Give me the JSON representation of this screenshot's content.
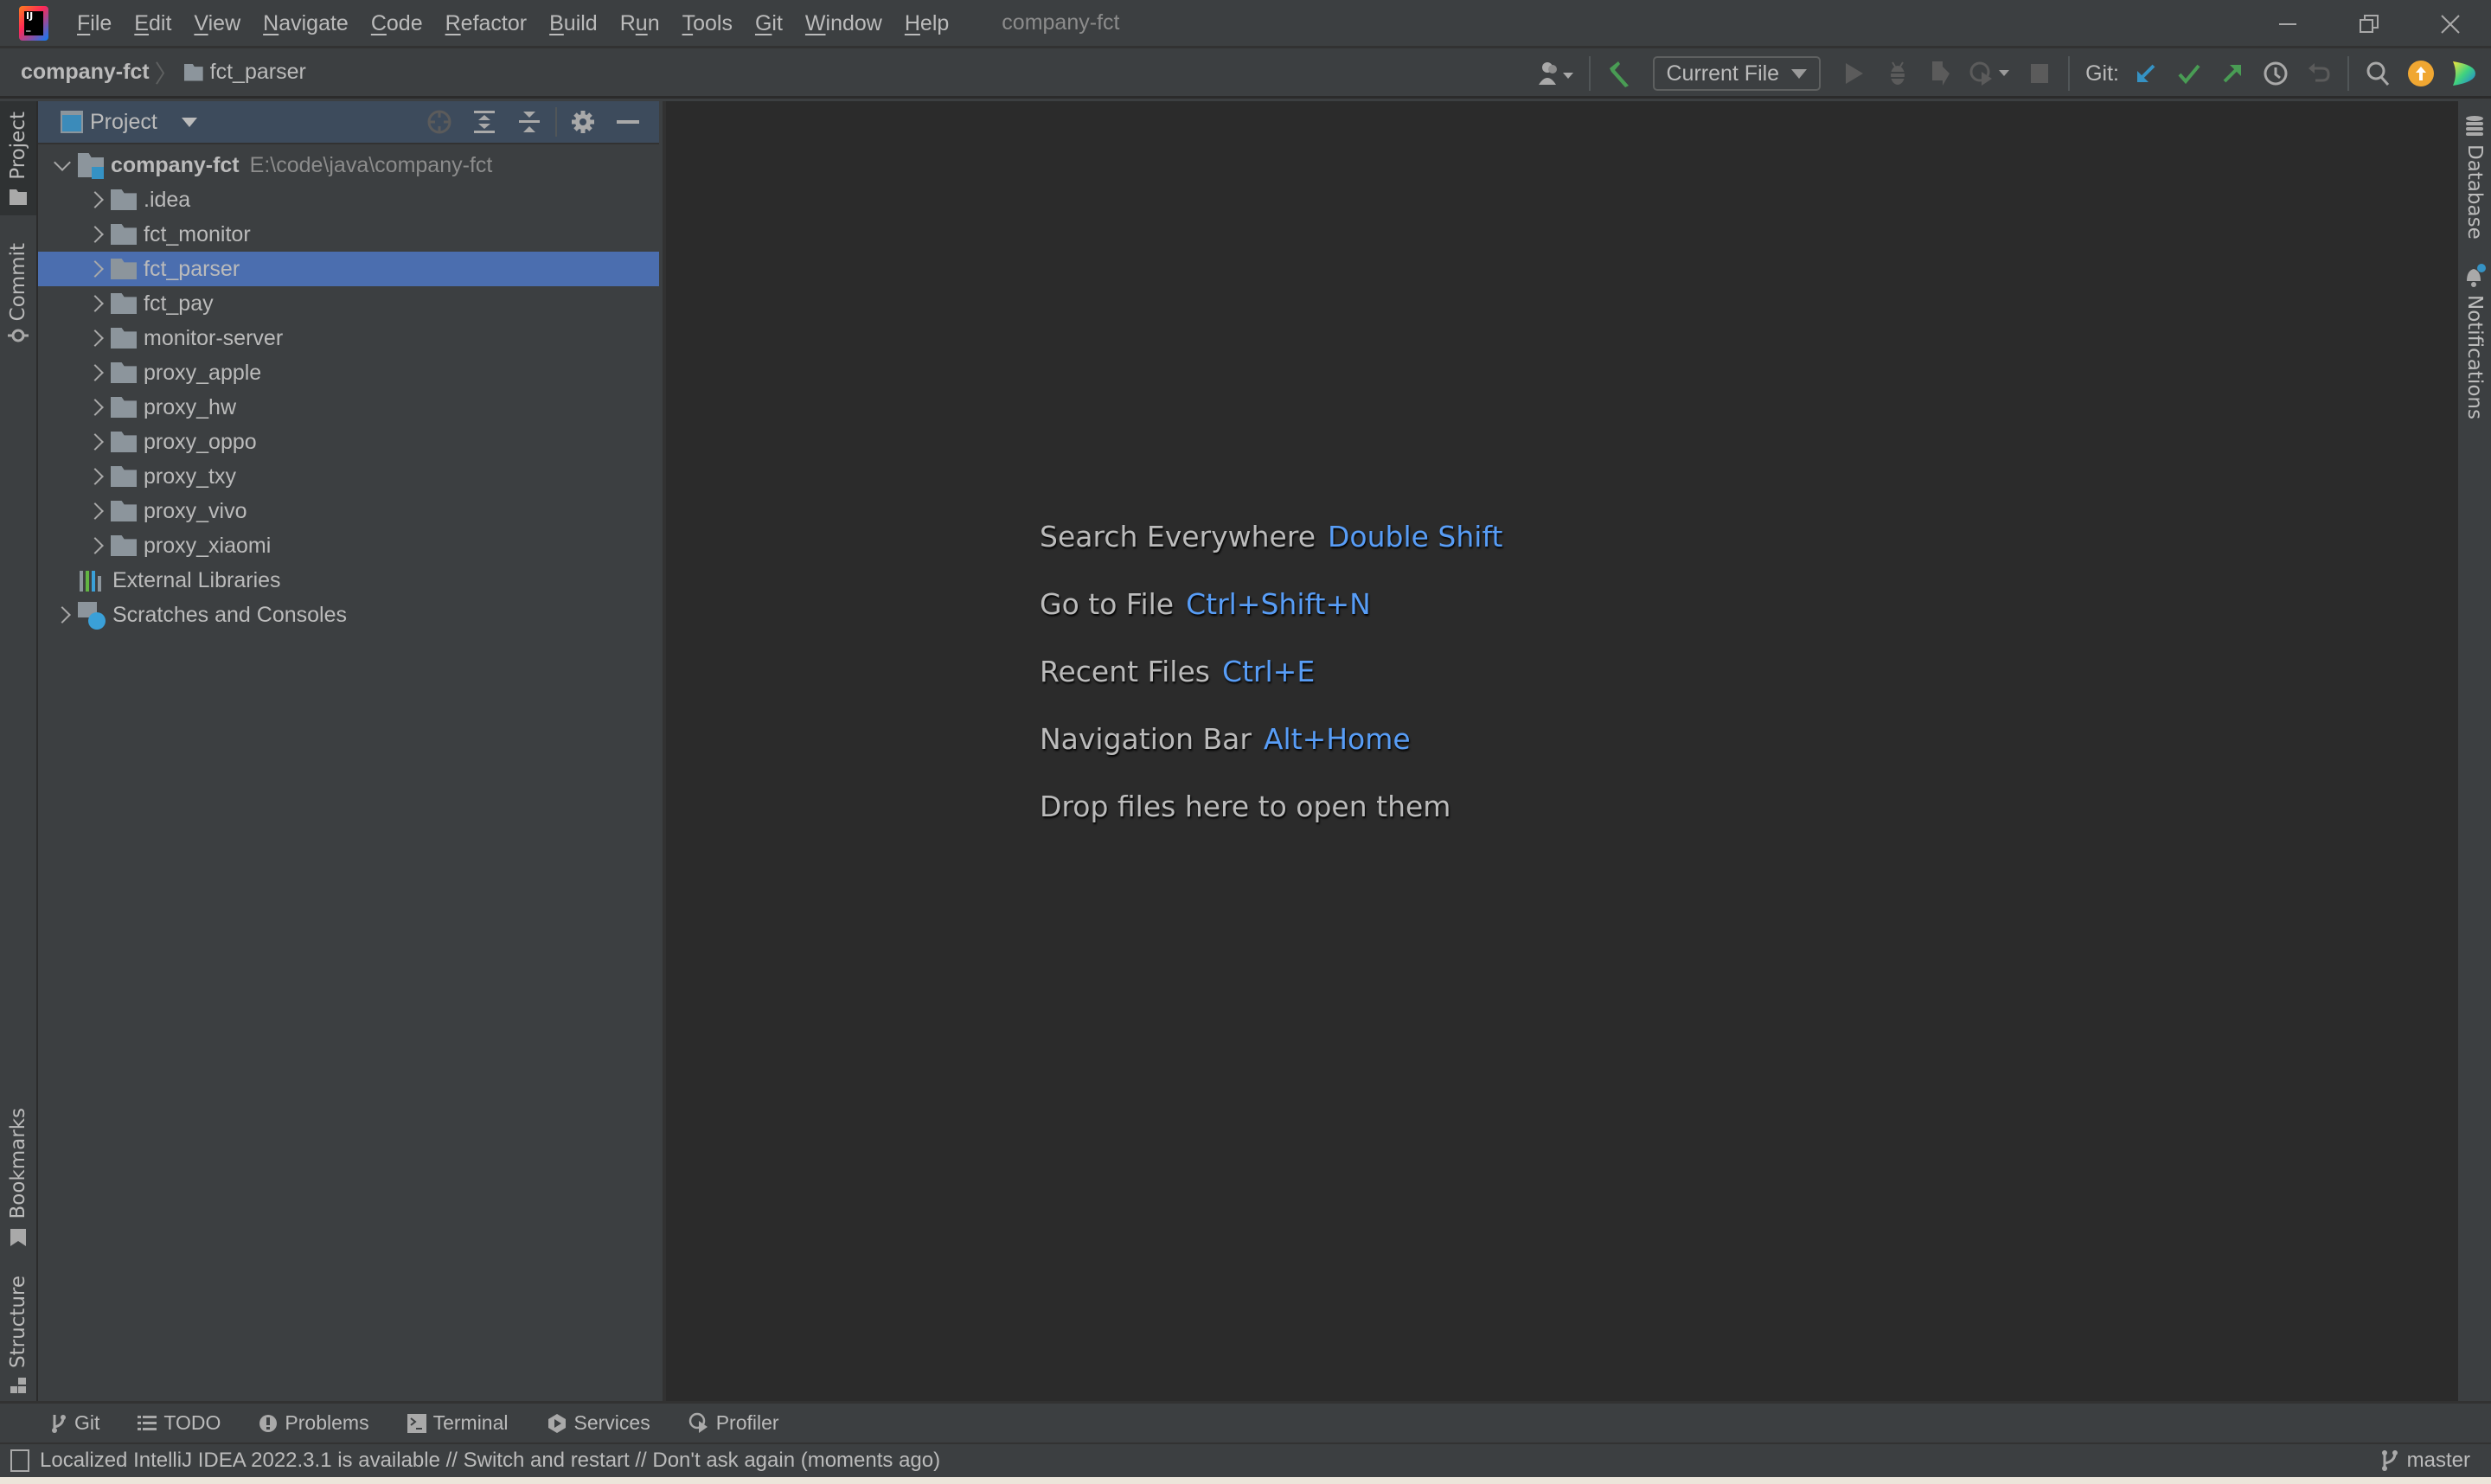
{
  "titlebar": {
    "app_icon": "intellij-idea-icon",
    "menu": [
      {
        "label": "File",
        "mnemonic": "F",
        "rest": "ile"
      },
      {
        "label": "Edit",
        "mnemonic": "E",
        "rest": "dit"
      },
      {
        "label": "View",
        "mnemonic": "V",
        "rest": "iew"
      },
      {
        "label": "Navigate",
        "mnemonic": "N",
        "rest": "avigate"
      },
      {
        "label": "Code",
        "mnemonic": "C",
        "rest": "ode"
      },
      {
        "label": "Refactor",
        "mnemonic": "R",
        "rest": "efactor"
      },
      {
        "label": "Build",
        "mnemonic": "B",
        "rest": "uild"
      },
      {
        "label": "Run",
        "pre": "R",
        "mnemonic": "u",
        "rest": "n"
      },
      {
        "label": "Tools",
        "mnemonic": "T",
        "rest": "ools"
      },
      {
        "label": "Git",
        "mnemonic": "G",
        "rest": "it"
      },
      {
        "label": "Window",
        "mnemonic": "W",
        "rest": "indow"
      },
      {
        "label": "Help",
        "mnemonic": "H",
        "rest": "elp"
      }
    ],
    "window_title": "company-fct",
    "controls": {
      "minimize": "minimize-icon",
      "restore": "restore-icon",
      "close": "close-icon"
    }
  },
  "navbar": {
    "breadcrumb": {
      "root": "company-fct",
      "separator": "〉",
      "current": "fct_parser"
    },
    "toolbar": {
      "run_config": "Current File",
      "git_label": "Git:",
      "colors": {
        "build": "#499c54",
        "update": "#3592c4",
        "commit": "#499c54",
        "push": "#499c54",
        "update_badge": "#f0a732"
      }
    }
  },
  "left_strip": {
    "tabs": [
      {
        "label": "Project",
        "active": true
      },
      {
        "label": "Commit"
      },
      {
        "label": "Bookmarks"
      },
      {
        "label": "Structure"
      }
    ]
  },
  "right_strip": {
    "tabs": [
      {
        "label": "Database"
      },
      {
        "label": "Notifications"
      }
    ]
  },
  "project_panel": {
    "title": "Project",
    "root": {
      "name": "company-fct",
      "path": "E:\\code\\java\\company-fct"
    },
    "children": [
      {
        "name": ".idea",
        "selected": false
      },
      {
        "name": "fct_monitor",
        "selected": false
      },
      {
        "name": "fct_parser",
        "selected": true
      },
      {
        "name": "fct_pay",
        "selected": false
      },
      {
        "name": "monitor-server",
        "selected": false
      },
      {
        "name": "proxy_apple",
        "selected": false
      },
      {
        "name": "proxy_hw",
        "selected": false
      },
      {
        "name": "proxy_oppo",
        "selected": false
      },
      {
        "name": "proxy_txy",
        "selected": false
      },
      {
        "name": "proxy_vivo",
        "selected": false
      },
      {
        "name": "proxy_xiaomi",
        "selected": false
      }
    ],
    "external_libraries": "External Libraries",
    "scratches": "Scratches and Consoles",
    "selection_color": "#4b6eaf"
  },
  "editor": {
    "hints": [
      {
        "text": "Search Everywhere",
        "key": "Double Shift"
      },
      {
        "text": "Go to File",
        "key": "Ctrl+Shift+N"
      },
      {
        "text": "Recent Files",
        "key": "Ctrl+E"
      },
      {
        "text": "Navigation Bar",
        "key": "Alt+Home"
      },
      {
        "text": "Drop files here to open them",
        "key": ""
      }
    ],
    "key_color": "#589df6"
  },
  "bottom_tabs": [
    {
      "label": "Git",
      "icon": "git-branch-icon"
    },
    {
      "label": "TODO",
      "icon": "list-icon"
    },
    {
      "label": "Problems",
      "icon": "warning-icon"
    },
    {
      "label": "Terminal",
      "icon": "terminal-icon"
    },
    {
      "label": "Services",
      "icon": "services-icon"
    },
    {
      "label": "Profiler",
      "icon": "profiler-icon"
    }
  ],
  "statusbar": {
    "message": "Localized IntelliJ IDEA 2022.3.1 is available // Switch and restart // Don't ask again (moments ago)",
    "branch": "master"
  }
}
